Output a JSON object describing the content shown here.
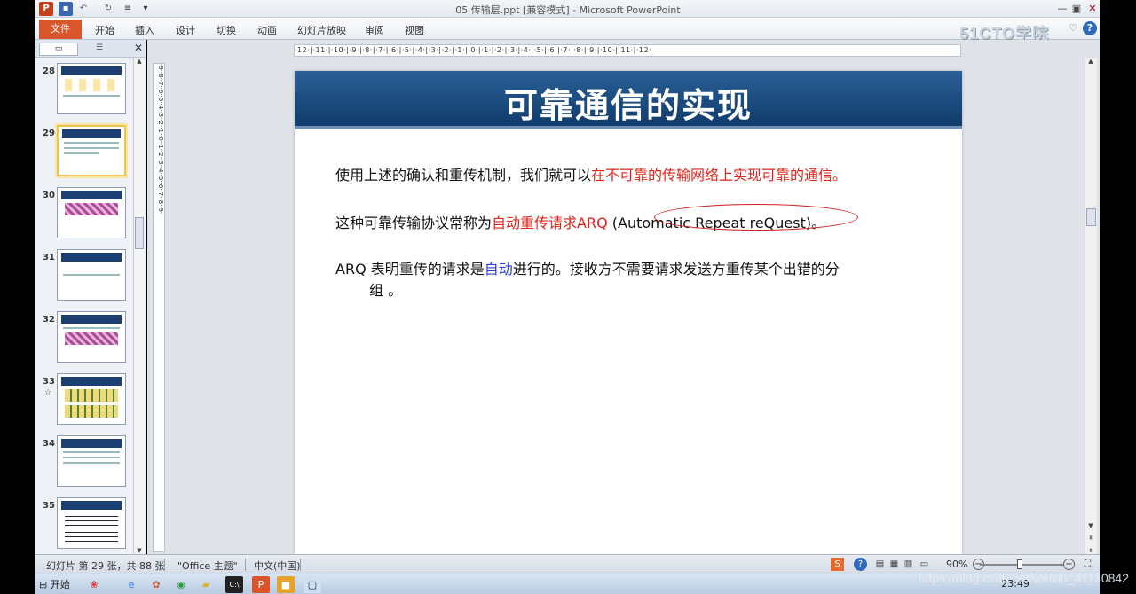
{
  "window": {
    "title": "05 传输层.ppt [兼容模式] - Microsoft PowerPoint",
    "app_icon": "P",
    "min": "—",
    "max": "▣",
    "close": "✕"
  },
  "ribbon": {
    "file": "文件",
    "tabs": [
      "开始",
      "插入",
      "设计",
      "切换",
      "动画",
      "幻灯片放映",
      "审阅",
      "视图"
    ],
    "logo": "51CTO学院"
  },
  "thumbnails": [
    {
      "num": "28"
    },
    {
      "num": "29",
      "selected": true
    },
    {
      "num": "30"
    },
    {
      "num": "31"
    },
    {
      "num": "32"
    },
    {
      "num": "33",
      "star": "☆"
    },
    {
      "num": "34"
    },
    {
      "num": "35"
    }
  ],
  "ruler": {
    "horizontal": "·12·|·11·|·10·|·9·|·8·|·7·|·6·|·5·|·4·|·3·|·2·|·1·|·0·|·1·|·2·|·3·|·4·|·5·|·6·|·7·|·8·|·9·|·10·|·11·|·12·",
    "vertical": "·9··8··7··6··5··4··3··2··1··0··1··2··3··4··5··6··7··8··9·"
  },
  "slide": {
    "title": "可靠通信的实现",
    "para1_plain": "使用上述的确认和重传机制，我们就可以",
    "para1_red": "在不可靠的传输网络上实现可靠的通信。",
    "para2_plain": "这种可靠传输协议常称为",
    "para2_red": "自动重传请求ARQ",
    "para2_paren_open": " (",
    "para2_automatic": "Automatic",
    "para2_repeat": "Repeat",
    "para2_request": "reQuest",
    "para2_end": ")。",
    "para3_a": "ARQ 表明重传的请求是",
    "para3_blue": "自动",
    "para3_b": "进行的。接收方不需要请求发送方重传某个出错的分",
    "para3_c": "组 。"
  },
  "status": {
    "slide_info": "幻灯片 第 29 张，共 88 张",
    "theme": "\"Office 主题\"",
    "language": "中文(中国)",
    "zoom": "90%"
  },
  "taskbar": {
    "start": "开始",
    "clock": "23:49"
  },
  "watermark": "https://blog.csdn.net/weixin_41130842",
  "colors": {
    "title_bar": "#1b4a7d",
    "accent_red": "#e2231a",
    "accent_blue": "#2b3fd6"
  }
}
